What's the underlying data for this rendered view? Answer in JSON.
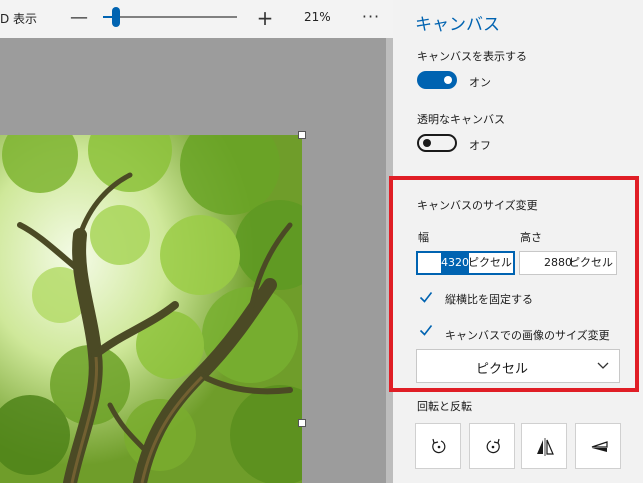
{
  "toolbar": {
    "view_label": "D 表示",
    "zoom_minus": "—",
    "zoom_plus": "+",
    "zoom_value": "21%",
    "zoom_level": 0.1,
    "more": "···"
  },
  "panel": {
    "title": "キャンバス",
    "show_canvas": {
      "label": "キャンバスを表示する",
      "state": "オン",
      "on": true
    },
    "transparent_canvas": {
      "label": "透明なキャンバス",
      "state": "オフ",
      "on": false
    },
    "resize": {
      "title": "キャンバスのサイズ変更",
      "width_label": "幅",
      "height_label": "高さ",
      "width_value": "4320",
      "unit": "ピクセル",
      "height_value": "2880",
      "lock_aspect": {
        "label": "縦横比を固定する",
        "checked": true
      },
      "resize_image": {
        "label": "キャンバスでの画像のサイズ変更",
        "checked": true
      },
      "units_dropdown": "ピクセル"
    },
    "rotate_flip": {
      "title": "回転と反転",
      "buttons": [
        "rotate-left-icon",
        "rotate-right-icon",
        "flip-horizontal-icon",
        "flip-vertical-icon"
      ]
    }
  },
  "colors": {
    "accent": "#0063b1",
    "highlight": "#e01e26",
    "canvas_bg": "#9c9c9c",
    "panel_bg": "#f2f2f2"
  }
}
